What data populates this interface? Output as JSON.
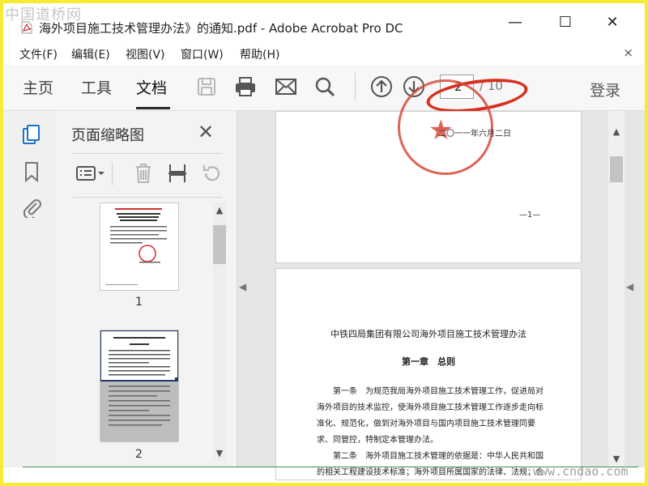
{
  "watermark": {
    "top_left": "中国道桥网",
    "bottom_right": "www.cndao.com"
  },
  "titlebar": {
    "title": "海外项目施工技术管理办法》的通知.pdf - Adobe Acrobat Pro DC",
    "minimize": "—",
    "maximize": "☐",
    "close": "✕"
  },
  "menu": {
    "items": [
      "文件(F)",
      "编辑(E)",
      "视图(V)",
      "窗口(W)",
      "帮助(H)"
    ],
    "close": "×"
  },
  "toolbar": {
    "tabs": [
      "主页",
      "工具",
      "文档"
    ],
    "active_tab": "文档",
    "icons": [
      "save-icon",
      "print-icon",
      "email-icon",
      "search-icon",
      "page-up-icon",
      "page-down-icon"
    ],
    "page_current": "2",
    "page_total": "/ 10",
    "login": "登录",
    "highlight_color": "#d8301f"
  },
  "rail": {
    "icons": [
      "thumbnails-icon",
      "bookmark-icon",
      "attachment-icon"
    ]
  },
  "panel": {
    "title": "页面缩略图",
    "close": "✕",
    "tools": [
      "thumbnail-options-icon",
      "delete-page-icon",
      "extract-page-icon",
      "rotate-page-icon"
    ],
    "thumbnails": [
      {
        "label": "1"
      },
      {
        "label": "2"
      }
    ]
  },
  "document": {
    "page1": {
      "date": "二〇一一年六月二日",
      "page_number": "—1—"
    },
    "page2": {
      "title": "中铁四局集团有限公司海外项目施工技术管理办法",
      "chapter": "第一章　总则",
      "lines": [
        "第一条　为规范我局海外项目施工技术管理工作，促进局对",
        "海外项目的技术监控，使海外项目施工技术管理工作逐步走向标",
        "准化、规范化，做到对海外项目与国内项目施工技术管理同要",
        "求、同管控，特制定本管理办法。",
        "第二条　海外项目施工技术管理的依据是：中华人民共和国",
        "的相关工程建设技术标准；海外项目所属国家的法律、法规；合"
      ]
    }
  }
}
